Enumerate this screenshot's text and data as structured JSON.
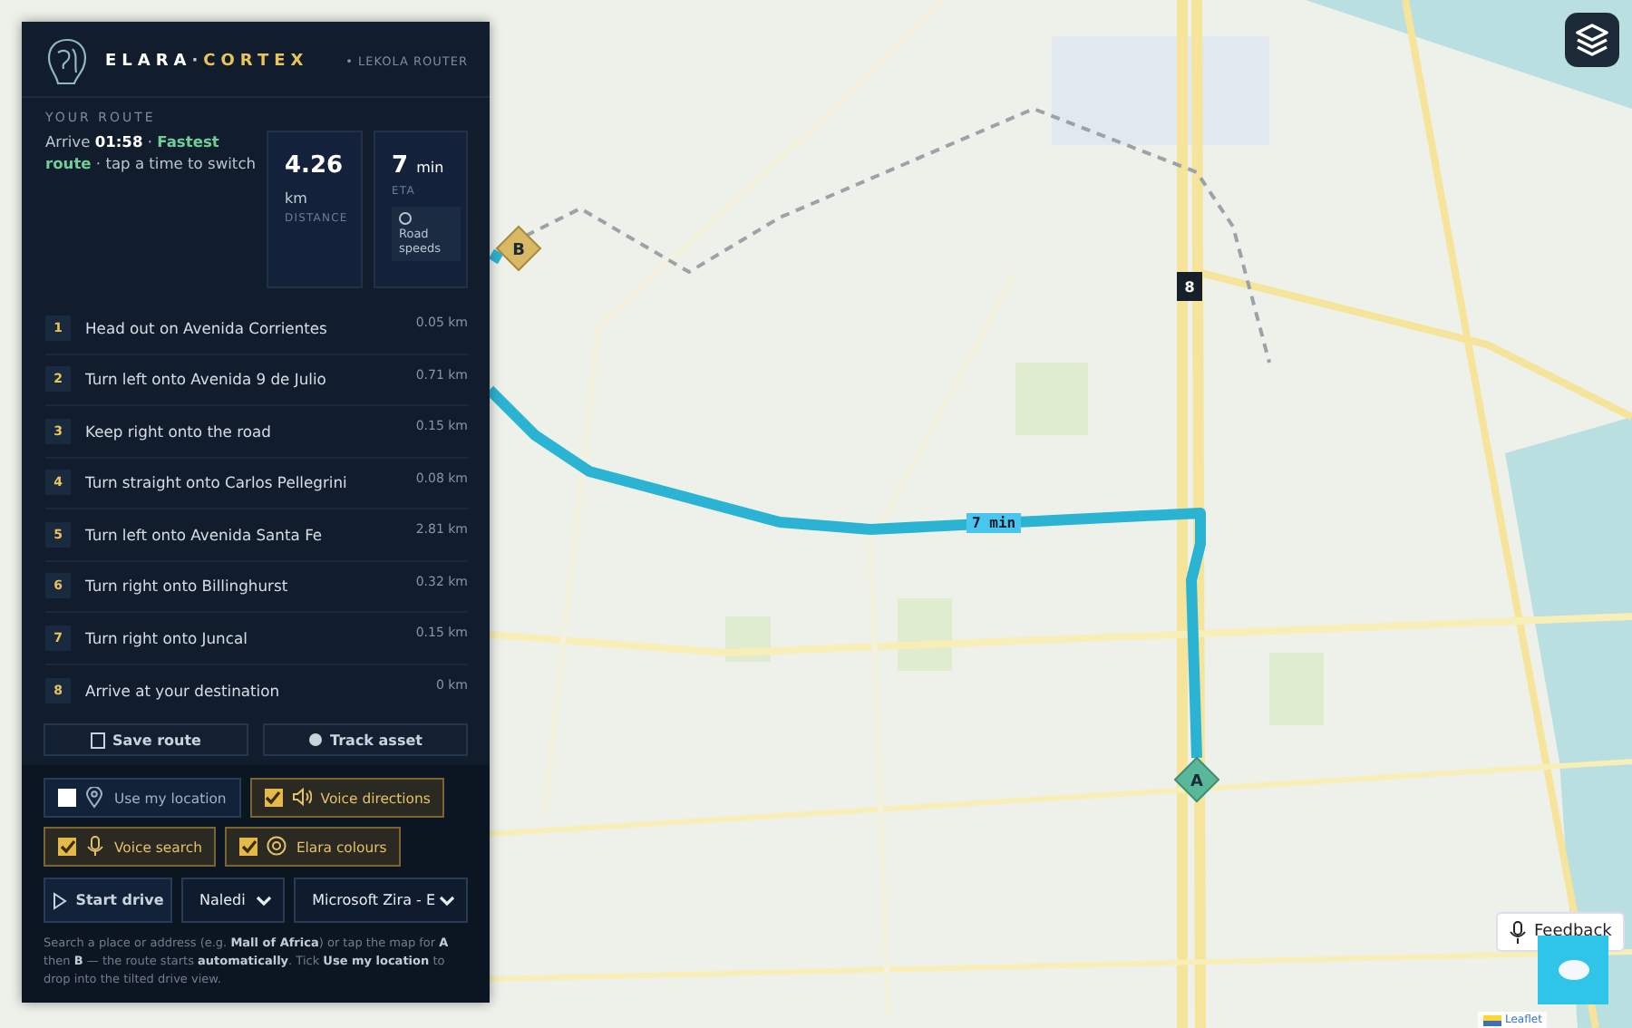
{
  "header": {
    "brand_left": "ELARA",
    "brand_dot": "·",
    "brand_right": "CORTEX",
    "router_link": "• LEKOLA ROUTER"
  },
  "route_summary": {
    "section_title": "YOUR ROUTE",
    "arrive_label": "Arrive",
    "arrive_time": "01:58",
    "separator": "·",
    "route_type": "Fastest route",
    "hint": "tap a time to switch"
  },
  "stats": {
    "distance": {
      "value": "4.26",
      "unit": "km",
      "label": "DISTANCE"
    },
    "eta": {
      "value": "7",
      "unit": "min",
      "label": "ETA"
    },
    "road_speeds": {
      "label": "Road speeds",
      "checked": false
    }
  },
  "steps": [
    {
      "number": "1",
      "text": "Head out on Avenida Corrientes",
      "distance": "0.05 km"
    },
    {
      "number": "2",
      "text": "Turn left onto Avenida 9 de Julio",
      "distance": "0.71 km"
    },
    {
      "number": "3",
      "text": "Keep right onto the road",
      "distance": "0.15 km"
    },
    {
      "number": "4",
      "text": "Turn straight onto Carlos Pellegrini",
      "distance": "0.08 km"
    },
    {
      "number": "5",
      "text": "Turn left onto Avenida Santa Fe",
      "distance": "2.81 km"
    },
    {
      "number": "6",
      "text": "Turn right onto Billinghurst",
      "distance": "0.32 km"
    },
    {
      "number": "7",
      "text": "Turn right onto Juncal",
      "distance": "0.15 km"
    },
    {
      "number": "8",
      "text": "Arrive at your destination",
      "distance": "0 km"
    }
  ],
  "actions": [
    {
      "kind": "save",
      "label": "Save route"
    },
    {
      "kind": "track",
      "label": "Track asset"
    }
  ],
  "options": [
    {
      "kind": "location",
      "label": "Use my location",
      "checked": false
    },
    {
      "kind": "speaker",
      "label": "Voice directions",
      "checked": true
    },
    {
      "kind": "mic",
      "label": "Voice search",
      "checked": true
    },
    {
      "kind": "palette",
      "label": "Elara colours",
      "checked": true
    }
  ],
  "controls": {
    "start_button": "Start drive",
    "voice_select": "Naledi",
    "engine_select": "Microsoft Zira - E"
  },
  "help_text": "Search a place or address (e.g. **Mall of Africa**) or tap the map for **A** then **B** — the route starts **automatically**. Tick **Use my location** to drop into the tilted drive view.",
  "map": {
    "route_label": "7 min",
    "start_marker": "A",
    "end_marker": "B",
    "stop_marker": "8",
    "feedback_button": "Feedback",
    "attribution": "Leaflet"
  }
}
